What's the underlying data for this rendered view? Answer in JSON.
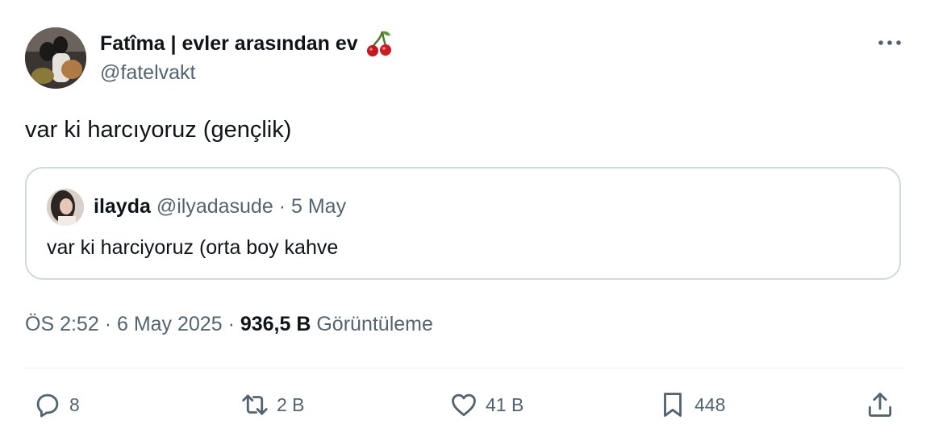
{
  "author": {
    "display_name": "Fatîma | evler arasından ev",
    "emoji_icon": "cherries-icon",
    "handle": "@fatelvakt"
  },
  "tweet": {
    "text": "var ki harcıyoruz (gençlik)"
  },
  "quote": {
    "name": "ilayda",
    "handle": "@ilyadasude",
    "separator": "·",
    "date": "5 May",
    "text": "var ki harciyoruz (orta boy kahve"
  },
  "meta": {
    "time": "ÖS 2:52",
    "dot1": "·",
    "date": "6 May 2025",
    "dot2": "·",
    "views_count": "936,5 B",
    "views_label": "Görüntüleme"
  },
  "actions": {
    "replies": "8",
    "reposts": "2 B",
    "likes": "41 B",
    "bookmarks": "448"
  },
  "colors": {
    "text_primary": "#0f1419",
    "text_secondary": "#536471",
    "border": "#cfd9de"
  }
}
